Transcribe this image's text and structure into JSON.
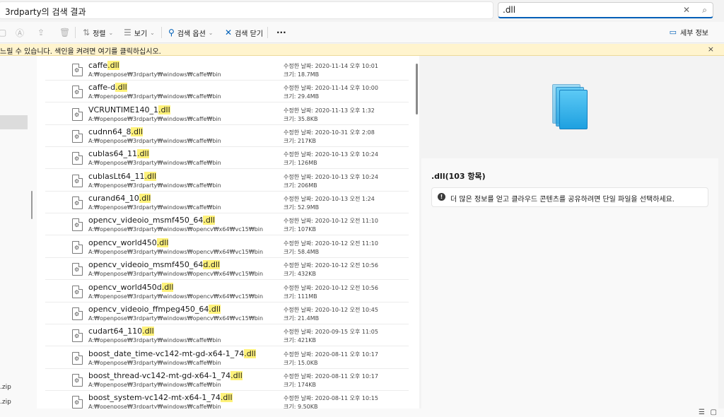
{
  "location": "3rdparty의 검색 결과",
  "search": {
    "value": ".dll",
    "clear_icon": "✕",
    "search_icon": "⌕"
  },
  "toolbar": {
    "sort": "정렬",
    "view": "보기",
    "search_options": "검색 옵션",
    "close_search": "검색 닫기",
    "more": "···",
    "details": "세부 정보"
  },
  "warning": {
    "text": "느릴 수 있습니다. 색인을 켜려면 여기를 클릭하십시오.",
    "close": "×"
  },
  "nav": {
    "items": [
      ".zip",
      ".zip"
    ]
  },
  "files": [
    {
      "name_pre": "caffe",
      "name_hl": ".dll",
      "name_post": "",
      "path": "A:₩openpose₩3rdparty₩windows₩caffe₩bin",
      "date": "수정한 날짜: 2020-11-14 오후 10:01",
      "size": "크기: 18.7MB"
    },
    {
      "name_pre": "caffe-d",
      "name_hl": ".dll",
      "name_post": "",
      "path": "A:₩openpose₩3rdparty₩windows₩caffe₩bin",
      "date": "수정한 날짜: 2020-11-14 오후 10:00",
      "size": "크기: 29.4MB"
    },
    {
      "name_pre": "VCRUNTIME140_1",
      "name_hl": ".dll",
      "name_post": "",
      "path": "A:₩openpose₩3rdparty₩windows₩caffe₩bin",
      "date": "수정한 날짜: 2020-11-13 오후 1:32",
      "size": "크기: 35.8KB"
    },
    {
      "name_pre": "cudnn64_8",
      "name_hl": ".dll",
      "name_post": "",
      "path": "A:₩openpose₩3rdparty₩windows₩caffe₩bin",
      "date": "수정한 날짜: 2020-10-31 오후 2:08",
      "size": "크기: 217KB"
    },
    {
      "name_pre": "cublas64_11",
      "name_hl": ".dll",
      "name_post": "",
      "path": "A:₩openpose₩3rdparty₩windows₩caffe₩bin",
      "date": "수정한 날짜: 2020-10-13 오후 10:24",
      "size": "크기: 126MB"
    },
    {
      "name_pre": "cublasLt64_11",
      "name_hl": ".dll",
      "name_post": "",
      "path": "A:₩openpose₩3rdparty₩windows₩caffe₩bin",
      "date": "수정한 날짜: 2020-10-13 오후 10:24",
      "size": "크기: 206MB"
    },
    {
      "name_pre": "curand64_10",
      "name_hl": ".dll",
      "name_post": "",
      "path": "A:₩openpose₩3rdparty₩windows₩caffe₩bin",
      "date": "수정한 날짜: 2020-10-13 오전 1:24",
      "size": "크기: 52.9MB"
    },
    {
      "name_pre": "opencv_videoio_msmf450_64",
      "name_hl": ".dll",
      "name_post": "",
      "path": "A:₩openpose₩3rdparty₩windows₩opencv₩x64₩vc15₩bin",
      "date": "수정한 날짜: 2020-10-12 오전 11:10",
      "size": "크기: 107KB"
    },
    {
      "name_pre": "opencv_world450",
      "name_hl": ".dll",
      "name_post": "",
      "path": "A:₩openpose₩3rdparty₩windows₩opencv₩x64₩vc15₩bin",
      "date": "수정한 날짜: 2020-10-12 오전 11:10",
      "size": "크기: 58.4MB"
    },
    {
      "name_pre": "opencv_videoio_msmf450_64",
      "name_hl": "d.dll",
      "name_post": "",
      "path": "A:₩openpose₩3rdparty₩windows₩opencv₩x64₩vc15₩bin",
      "date": "수정한 날짜: 2020-10-12 오전 10:56",
      "size": "크기: 432KB"
    },
    {
      "name_pre": "opencv_world450d",
      "name_hl": ".dll",
      "name_post": "",
      "path": "A:₩openpose₩3rdparty₩windows₩opencv₩x64₩vc15₩bin",
      "date": "수정한 날짜: 2020-10-12 오전 10:56",
      "size": "크기: 111MB"
    },
    {
      "name_pre": "opencv_videoio_ffmpeg450_64",
      "name_hl": ".dll",
      "name_post": "",
      "path": "A:₩openpose₩3rdparty₩windows₩opencv₩x64₩vc15₩bin",
      "date": "수정한 날짜: 2020-10-12 오전 10:45",
      "size": "크기: 21.4MB"
    },
    {
      "name_pre": "cudart64_110",
      "name_hl": ".dll",
      "name_post": "",
      "path": "A:₩openpose₩3rdparty₩windows₩caffe₩bin",
      "date": "수정한 날짜: 2020-09-15 오후 11:05",
      "size": "크기: 421KB"
    },
    {
      "name_pre": "boost_date_time-vc142-mt-gd-x64-1_74",
      "name_hl": ".dll",
      "name_post": "",
      "path": "A:₩openpose₩3rdparty₩windows₩caffe₩bin",
      "date": "수정한 날짜: 2020-08-11 오후 10:17",
      "size": "크기: 15.0KB"
    },
    {
      "name_pre": "boost_thread-vc142-mt-gd-x64-1_74",
      "name_hl": ".dll",
      "name_post": "",
      "path": "A:₩openpose₩3rdparty₩windows₩caffe₩bin",
      "date": "수정한 날짜: 2020-08-11 오후 10:17",
      "size": "크기: 174KB"
    },
    {
      "name_pre": "boost_system-vc142-mt-x64-1_74",
      "name_hl": ".dll",
      "name_post": "",
      "path": "A:₩openpose₩3rdparty₩windows₩caffe₩bin",
      "date": "수정한 날짜: 2020-08-11 오후 10:15",
      "size": "크기: 9.50KB"
    }
  ],
  "details_pane": {
    "title": ".dll(103 항목)",
    "info": "더 많은 정보를 얻고 클라우드 콘텐츠를 공유하려면 단일 파일을 선택하세요."
  },
  "colors": {
    "accent": "#005fb8",
    "highlight": "#fff27a",
    "warning_bg": "#fff4ce"
  }
}
